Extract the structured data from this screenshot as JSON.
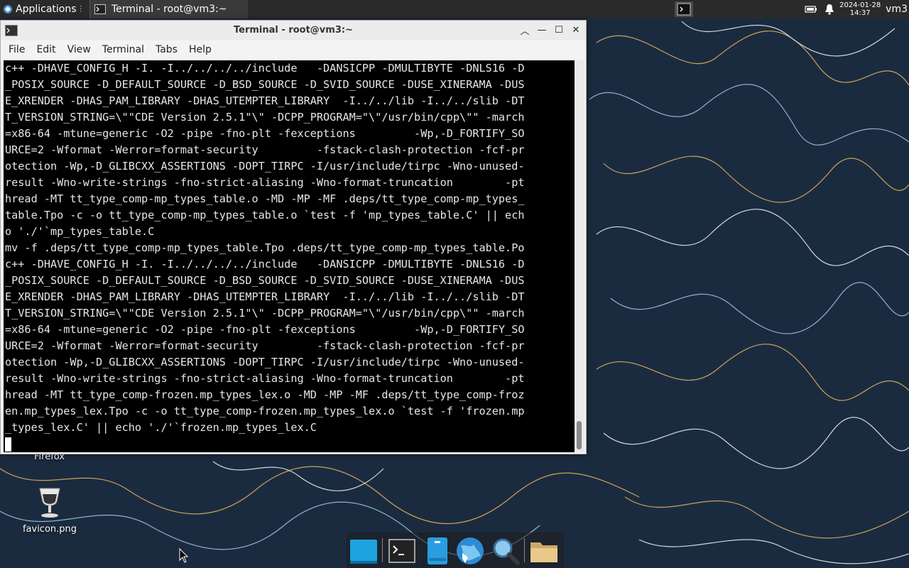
{
  "top_panel": {
    "applications_label": "Applications",
    "task_label": "Terminal - root@vm3:~",
    "clock_date": "2024-01-28",
    "clock_time": "14:37",
    "hostname": "vm3"
  },
  "window": {
    "title": "Terminal - root@vm3:~",
    "menu": [
      "File",
      "Edit",
      "View",
      "Terminal",
      "Tabs",
      "Help"
    ]
  },
  "terminal_lines": [
    "c++ -DHAVE_CONFIG_H -I. -I../../../../include   -DANSICPP -DMULTIBYTE -DNLS16 -D",
    "_POSIX_SOURCE -D_DEFAULT_SOURCE -D_BSD_SOURCE -D_SVID_SOURCE -DUSE_XINERAMA -DUS",
    "E_XRENDER -DHAS_PAM_LIBRARY -DHAS_UTEMPTER_LIBRARY  -I../../lib -I../../slib -DT",
    "T_VERSION_STRING=\\\"\"CDE Version 2.5.1\"\\\" -DCPP_PROGRAM=\"\\\"/usr/bin/cpp\\\"\" -march",
    "=x86-64 -mtune=generic -O2 -pipe -fno-plt -fexceptions         -Wp,-D_FORTIFY_SO",
    "URCE=2 -Wformat -Werror=format-security         -fstack-clash-protection -fcf-pr",
    "otection -Wp,-D_GLIBCXX_ASSERTIONS -DOPT_TIRPC -I/usr/include/tirpc -Wno-unused-",
    "result -Wno-write-strings -fno-strict-aliasing -Wno-format-truncation        -pt",
    "hread -MT tt_type_comp-mp_types_table.o -MD -MP -MF .deps/tt_type_comp-mp_types_",
    "table.Tpo -c -o tt_type_comp-mp_types_table.o `test -f 'mp_types_table.C' || ech",
    "o './'`mp_types_table.C",
    "mv -f .deps/tt_type_comp-mp_types_table.Tpo .deps/tt_type_comp-mp_types_table.Po",
    "c++ -DHAVE_CONFIG_H -I. -I../../../../include   -DANSICPP -DMULTIBYTE -DNLS16 -D",
    "_POSIX_SOURCE -D_DEFAULT_SOURCE -D_BSD_SOURCE -D_SVID_SOURCE -DUSE_XINERAMA -DUS",
    "E_XRENDER -DHAS_PAM_LIBRARY -DHAS_UTEMPTER_LIBRARY  -I../../lib -I../../slib -DT",
    "T_VERSION_STRING=\\\"\"CDE Version 2.5.1\"\\\" -DCPP_PROGRAM=\"\\\"/usr/bin/cpp\\\"\" -march",
    "=x86-64 -mtune=generic -O2 -pipe -fno-plt -fexceptions         -Wp,-D_FORTIFY_SO",
    "URCE=2 -Wformat -Werror=format-security         -fstack-clash-protection -fcf-pr",
    "otection -Wp,-D_GLIBCXX_ASSERTIONS -DOPT_TIRPC -I/usr/include/tirpc -Wno-unused-",
    "result -Wno-write-strings -fno-strict-aliasing -Wno-format-truncation        -pt",
    "hread -MT tt_type_comp-frozen.mp_types_lex.o -MD -MP -MF .deps/tt_type_comp-froz",
    "en.mp_types_lex.Tpo -c -o tt_type_comp-frozen.mp_types_lex.o `test -f 'frozen.mp",
    "_types_lex.C' || echo './'`frozen.mp_types_lex.C"
  ],
  "desktop": {
    "firefox_label": "Firefox",
    "favicon_label": "favicon.png"
  },
  "dock_items": [
    "workspace-icon",
    "terminal-icon",
    "file-manager-icon",
    "web-browser-icon",
    "search-icon",
    "folder-icon"
  ],
  "colors": {
    "desktop_bg": "#1b2b3f",
    "panel_bg": "#2a2a2a",
    "terminal_bg": "#000000",
    "terminal_fg": "#e6e6e6"
  }
}
